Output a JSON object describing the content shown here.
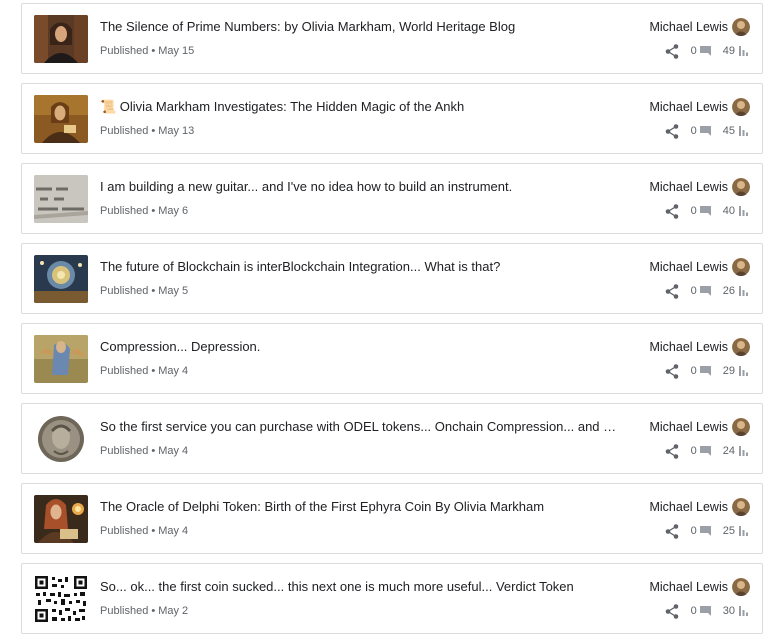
{
  "posts": [
    {
      "title": "The Silence of Prime Numbers: by Olivia Markham, World Heritage Blog",
      "status": "Published",
      "date": "May 15",
      "author": "Michael Lewis",
      "comments": "0",
      "views": "49",
      "thumb": "portrait-dark"
    },
    {
      "title": "📜 Olivia Markham Investigates: The Hidden Magic of the Ankh",
      "status": "Published",
      "date": "May 13",
      "author": "Michael Lewis",
      "comments": "0",
      "views": "45",
      "thumb": "portrait-warm"
    },
    {
      "title": "I am building a new guitar... and I've no idea how to build an instrument.",
      "status": "Published",
      "date": "May 6",
      "author": "Michael Lewis",
      "comments": "0",
      "views": "40",
      "thumb": "chalk-text"
    },
    {
      "title": "The future of Blockchain is interBlockchain Integration... What is that?",
      "status": "Published",
      "date": "May 5",
      "author": "Michael Lewis",
      "comments": "0",
      "views": "26",
      "thumb": "cosmic-sphere"
    },
    {
      "title": "Compression... Depression.",
      "status": "Published",
      "date": "May 4",
      "author": "Michael Lewis",
      "comments": "0",
      "views": "29",
      "thumb": "painted-angel"
    },
    {
      "title": "So the first service you can purchase with ODEL tokens... Onchain Compression... and Security",
      "status": "Published",
      "date": "May 4",
      "author": "Michael Lewis",
      "comments": "0",
      "views": "24",
      "thumb": "coin-relief"
    },
    {
      "title": "The Oracle of Delphi Token: Birth of the First Ephyra Coin By Olivia Markham",
      "status": "Published",
      "date": "May 4",
      "author": "Michael Lewis",
      "comments": "0",
      "views": "25",
      "thumb": "portrait-candle"
    },
    {
      "title": "So... ok... the first coin sucked... this next one is much more useful... Verdict Token",
      "status": "Published",
      "date": "May 2",
      "author": "Michael Lewis",
      "comments": "0",
      "views": "30",
      "thumb": "qr-code"
    }
  ],
  "icons": {
    "share": "share-icon",
    "comments": "comment-icon",
    "views": "bar-chart-icon"
  },
  "colors": {
    "border": "#dadce0",
    "text": "#202124",
    "muted": "#5f6368",
    "icon": "#5f6368",
    "stat_icon": "#9aa0a6"
  }
}
